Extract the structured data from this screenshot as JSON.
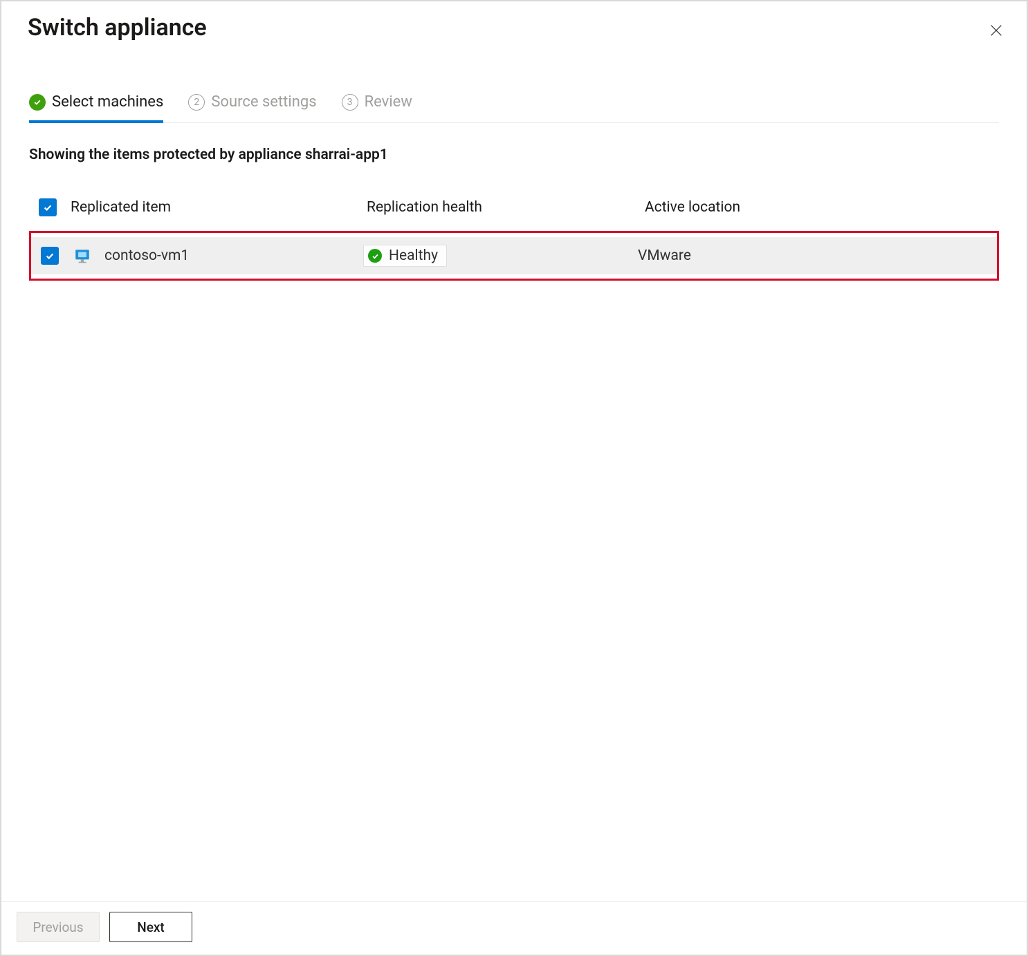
{
  "title": "Switch appliance",
  "steps": [
    {
      "label": "Select machines",
      "state": "active"
    },
    {
      "num": "2",
      "label": "Source settings",
      "state": "inactive"
    },
    {
      "num": "3",
      "label": "Review",
      "state": "inactive"
    }
  ],
  "description": "Showing the items protected by appliance sharrai-app1",
  "table": {
    "headers": {
      "item": "Replicated item",
      "health": "Replication health",
      "location": "Active location"
    },
    "rows": [
      {
        "name": "contoso-vm1",
        "health": "Healthy",
        "location": "VMware",
        "checked": true
      }
    ]
  },
  "footer": {
    "previous": "Previous",
    "next": "Next"
  }
}
